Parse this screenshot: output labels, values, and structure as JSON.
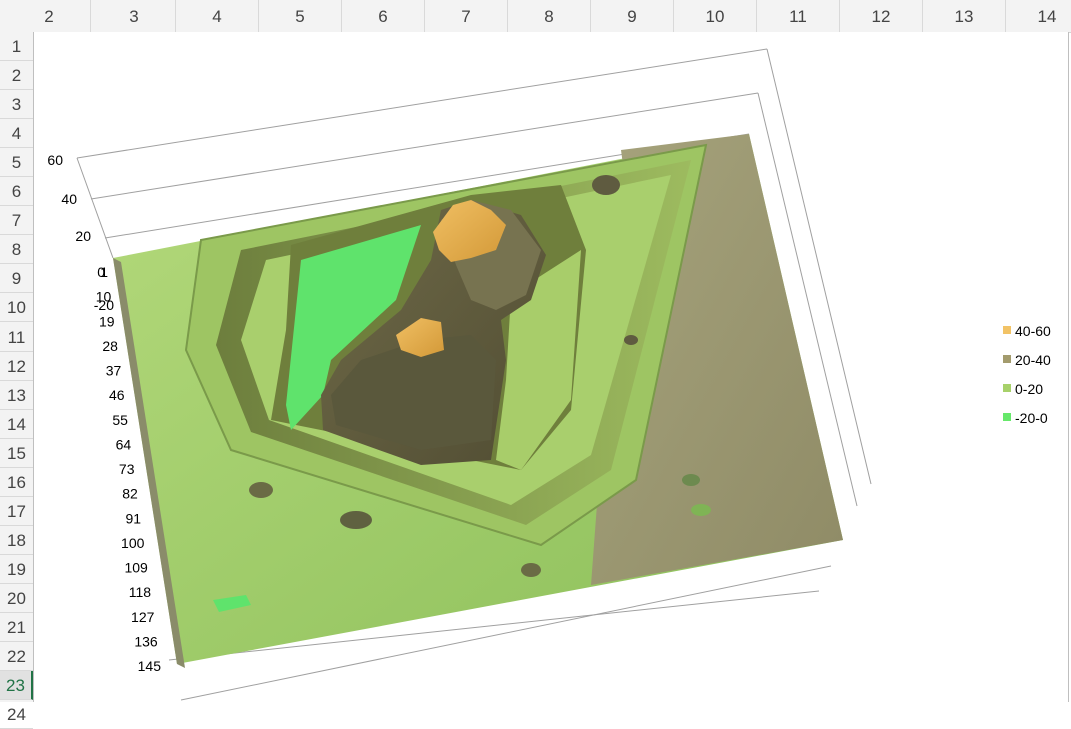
{
  "spreadsheet": {
    "column_headers": [
      "2",
      "3",
      "4",
      "5",
      "6",
      "7",
      "8",
      "9",
      "10",
      "11",
      "12",
      "13",
      "14"
    ],
    "row_headers": [
      "1",
      "2",
      "3",
      "4",
      "5",
      "6",
      "7",
      "8",
      "9",
      "10",
      "11",
      "12",
      "13",
      "14",
      "15",
      "16",
      "17",
      "18",
      "19",
      "20",
      "21",
      "22",
      "23",
      "24"
    ],
    "selected_row": "23"
  },
  "chart_data": {
    "type": "surface",
    "title": "",
    "z_axis": {
      "ticks": [
        "0",
        "20",
        "40",
        "60"
      ],
      "range": [
        0,
        60
      ]
    },
    "depth_axis": {
      "ticks": [
        "1",
        "10",
        "19",
        "28",
        "37",
        "46",
        "55",
        "64",
        "73",
        "82",
        "91",
        "100",
        "109",
        "118",
        "127",
        "136",
        "145"
      ]
    },
    "extra_tick": "-20",
    "legend": {
      "position": "right",
      "entries": [
        {
          "label": "40-60",
          "color": "#f2c366"
        },
        {
          "label": "20-40",
          "color": "#a39b6d"
        },
        {
          "label": "0-20",
          "color": "#a7d16a"
        },
        {
          "label": "-20-0",
          "color": "#66e86a"
        }
      ]
    },
    "colors": {
      "terrain_green": "#9fca6a",
      "terrain_olive": "#9a9670",
      "moat": "#5fe36c",
      "peak": "#e3a94a",
      "dark_slope": "#5a583c"
    }
  }
}
